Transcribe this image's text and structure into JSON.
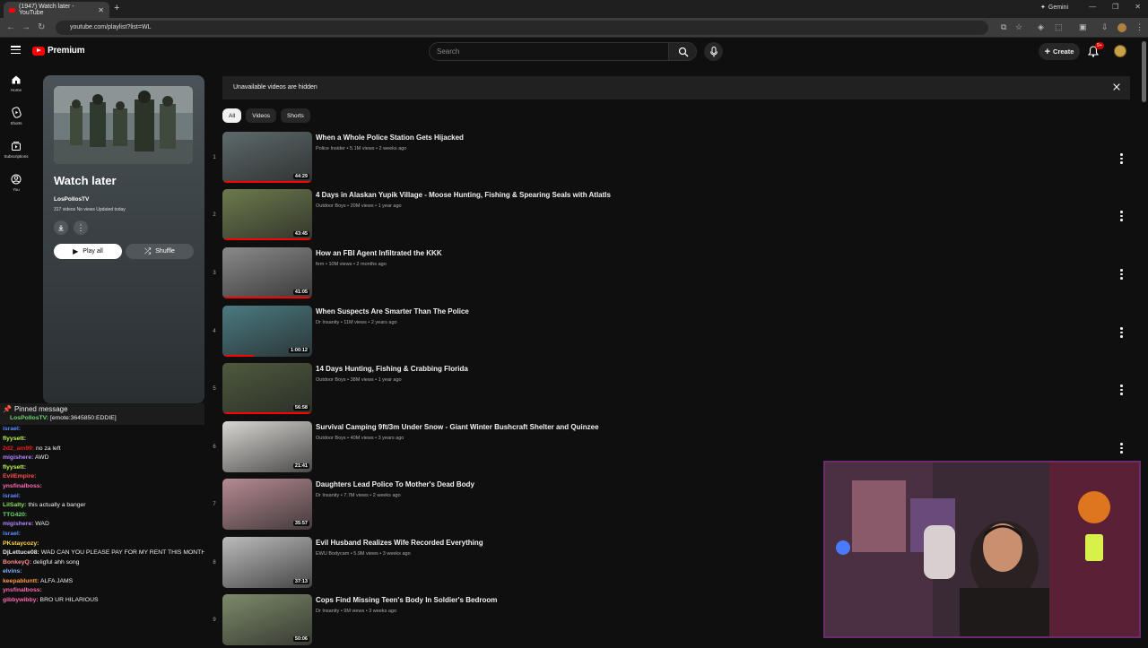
{
  "browser": {
    "tab_title": "(1947) Watch later - YouTube",
    "url": "youtube.com/playlist?list=WL",
    "gemini_label": "Gemini"
  },
  "header": {
    "logo_text": "Premium",
    "search_placeholder": "Search",
    "create_label": "Create",
    "notif_count": "9+"
  },
  "guide": [
    {
      "label": "Home",
      "icon": "home-icon"
    },
    {
      "label": "Shorts",
      "icon": "shorts-icon"
    },
    {
      "label": "Subscriptions",
      "icon": "subscriptions-icon"
    },
    {
      "label": "You",
      "icon": "you-icon"
    }
  ],
  "playlist": {
    "title": "Watch later",
    "owner": "LosPollosTV",
    "meta": "317 videos   No views   Updated today",
    "play_all_label": "Play all",
    "shuffle_label": "Shuffle"
  },
  "banner": {
    "text": "Unavailable videos are hidden"
  },
  "chips": [
    {
      "label": "All",
      "active": true
    },
    {
      "label": "Videos",
      "active": false
    },
    {
      "label": "Shorts",
      "active": false
    }
  ],
  "videos": [
    {
      "index": "1",
      "title": "When a Whole Police Station Gets Hijacked",
      "meta": "Police Insider • 5.1M views • 2 weeks ago",
      "duration": "44:29",
      "progress": 1.0,
      "thumb_color": "#5d6a6b"
    },
    {
      "index": "2",
      "title": "4 Days in Alaskan Yupik Village - Moose Hunting, Fishing & Spearing Seals with Atlatls",
      "meta": "Outdoor Boys • 20M views • 1 year ago",
      "duration": "43:45",
      "progress": 1.0,
      "thumb_color": "#6c7a4c"
    },
    {
      "index": "3",
      "title": "How an FBI Agent Infiltrated the KKK",
      "meta": "fern • 10M views • 2 months ago",
      "duration": "41:05",
      "progress": 1.0,
      "thumb_color": "#8a8a8a"
    },
    {
      "index": "4",
      "title": "When Suspects Are Smarter Than The Police",
      "meta": "Dr Insanity • 11M views • 2 years ago",
      "duration": "1:00:12",
      "progress": 0.35,
      "thumb_color": "#4a7a80"
    },
    {
      "index": "5",
      "title": "14 Days Hunting, Fishing & Crabbing Florida",
      "meta": "Outdoor Boys • 38M views • 1 year ago",
      "duration": "56:58",
      "progress": 1.0,
      "thumb_color": "#4e5a3e"
    },
    {
      "index": "6",
      "title": "Survival Camping 9ft/3m Under Snow - Giant Winter Bushcraft Shelter and Quinzee",
      "meta": "Outdoor Boys • 40M views • 3 years ago",
      "duration": "21:41",
      "progress": 0.0,
      "thumb_color": "#d8d6d2"
    },
    {
      "index": "7",
      "title": "Daughters Lead Police To Mother's Dead Body",
      "meta": "Dr Insanity • 7.7M views • 2 weeks ago",
      "duration": "35:57",
      "progress": 0.0,
      "thumb_color": "#b58a92"
    },
    {
      "index": "8",
      "title": "Evil Husband Realizes Wife Recorded Everything",
      "meta": "EWU Bodycam • 5.9M views • 3 weeks ago",
      "duration": "37:13",
      "progress": 0.0,
      "thumb_color": "#bcbcbc"
    },
    {
      "index": "9",
      "title": "Cops Find Missing Teen's Body In Soldier's Bedroom",
      "meta": "Dr Insanity • 9M views • 3 weeks ago",
      "duration": "50:06",
      "progress": 0.0,
      "thumb_color": "#7d8a6a"
    }
  ],
  "chat": {
    "pinned_label": "Pinned message",
    "pinned_user": "LosPollosTV:",
    "pinned_text": "[emote:3645850:EDDIE]",
    "lines": [
      {
        "user": "israel:",
        "text": "",
        "color": "#5b8cff"
      },
      {
        "user": "flyysett:",
        "text": "",
        "color": "#b9f25a"
      },
      {
        "user": "2d2_am99:",
        "text": "no za left",
        "color": "#e02020"
      },
      {
        "user": "migishere:",
        "text": "AWD",
        "color": "#b084ff"
      },
      {
        "user": "flyysett:",
        "text": "",
        "color": "#b9f25a"
      },
      {
        "user": "EvilEmpire:",
        "text": "",
        "color": "#ff4d4d"
      },
      {
        "user": "ynsfinalboss:",
        "text": "",
        "color": "#ff69b4"
      },
      {
        "user": "israel:",
        "text": "",
        "color": "#5b8cff"
      },
      {
        "user": "LilSalty:",
        "text": "this actually a banger",
        "color": "#8de05a"
      },
      {
        "user": "TTG420:",
        "text": "",
        "color": "#6fd66f"
      },
      {
        "user": "migishere:",
        "text": "WAD",
        "color": "#b084ff"
      },
      {
        "user": "israel:",
        "text": "",
        "color": "#5b8cff"
      },
      {
        "user": "PKstaycozy:",
        "text": "",
        "color": "#ffd54a"
      },
      {
        "user": "DjLettuce08:",
        "text": "WAD CAN YOU PLEASE PAY FOR MY RENT THIS MONTH?",
        "color": "#e8e8e8"
      },
      {
        "user": "BonkeyQ:",
        "text": "deligful ahh song",
        "color": "#ff8c8c"
      },
      {
        "user": "elvins:",
        "text": "",
        "color": "#7fb3ff"
      },
      {
        "user": "keepabluntt:",
        "text": "ALFA JAMS",
        "color": "#ff9a3c"
      },
      {
        "user": "ynsfinalboss:",
        "text": "",
        "color": "#ff69b4"
      },
      {
        "user": "gibbywibby:",
        "text": "BRO UR HILARIOUS",
        "color": "#ff69b4"
      }
    ]
  },
  "colors": {
    "brand_red": "#ff0000",
    "background": "#0f0f0f"
  }
}
